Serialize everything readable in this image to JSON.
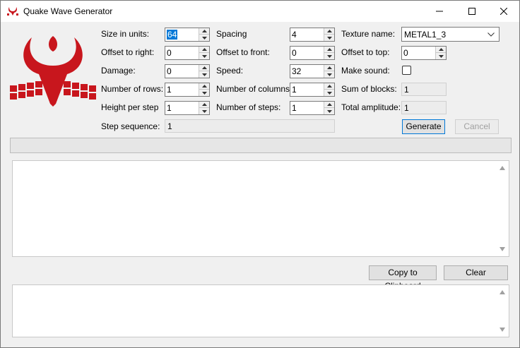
{
  "window": {
    "title": "Quake Wave Generator"
  },
  "col1": {
    "size_label": "Size in units:",
    "size_value": "64",
    "offset_right_label": "Offset to right:",
    "offset_right_value": "0",
    "damage_label": "Damage:",
    "damage_value": "0",
    "rows_label": "Number of rows:",
    "rows_value": "1",
    "height_step_label": "Height per step",
    "height_step_value": "1",
    "step_sequence_label": "Step sequence:",
    "step_sequence_value": "1"
  },
  "col2": {
    "spacing_label": "Spacing",
    "spacing_value": "4",
    "offset_front_label": "Offset to front:",
    "offset_front_value": "0",
    "speed_label": "Speed:",
    "speed_value": "32",
    "columns_label": "Number of columns:",
    "columns_value": "1",
    "steps_label": "Number of steps:",
    "steps_value": "1"
  },
  "col3": {
    "texture_label": "Texture name:",
    "texture_value": "METAL1_3",
    "offset_top_label": "Offset to top:",
    "offset_top_value": "0",
    "sound_label": "Make sound:",
    "sound_checked": false,
    "sum_blocks_label": "Sum of blocks:",
    "sum_blocks_value": "1",
    "amplitude_label": "Total amplitude:",
    "amplitude_value": "1"
  },
  "buttons": {
    "generate": "Generate",
    "cancel": "Cancel",
    "copy": "Copy to Clipboard",
    "clear": "Clear"
  },
  "colors": {
    "logo_red": "#c8161d",
    "accent": "#0078d7"
  }
}
